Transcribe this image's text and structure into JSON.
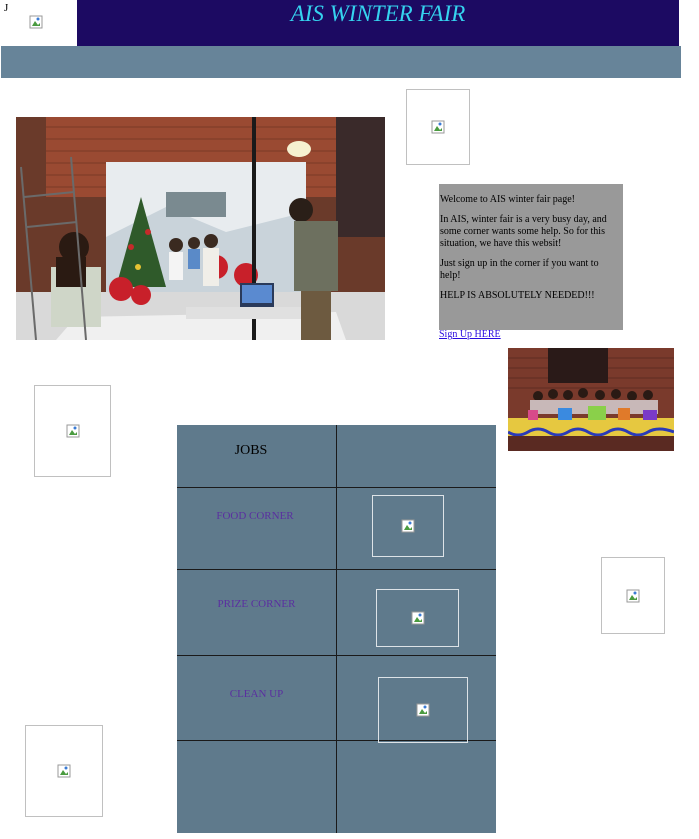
{
  "page": {
    "corner_letter": "J",
    "title": "AIS WINTER FAIR"
  },
  "welcome": {
    "line1": "Welcome to AIS winter fair page!",
    "line2": "In AIS, winter fair is a very busy day, and some corner wants some help. So for this situation, we have this websit!",
    "line3": "Just sign up in the corner if you want to help!",
    "line4": "HELP IS ABSOLUTELY NEEDED!!!",
    "signup_link": "Sign Up HERE"
  },
  "jobs": {
    "header": "JOBS",
    "rows": [
      "FOOD CORNER",
      "PRIZE CORNER",
      "CLEAN UP"
    ]
  },
  "colors": {
    "header_bg": "#1c0a62",
    "title_text": "#35d3ef",
    "nav_bar": "#678499",
    "welcome_bg": "#999999",
    "table_bg": "#5f7a8c",
    "job_text": "#5a2fa0",
    "link": "#2a0be0"
  }
}
